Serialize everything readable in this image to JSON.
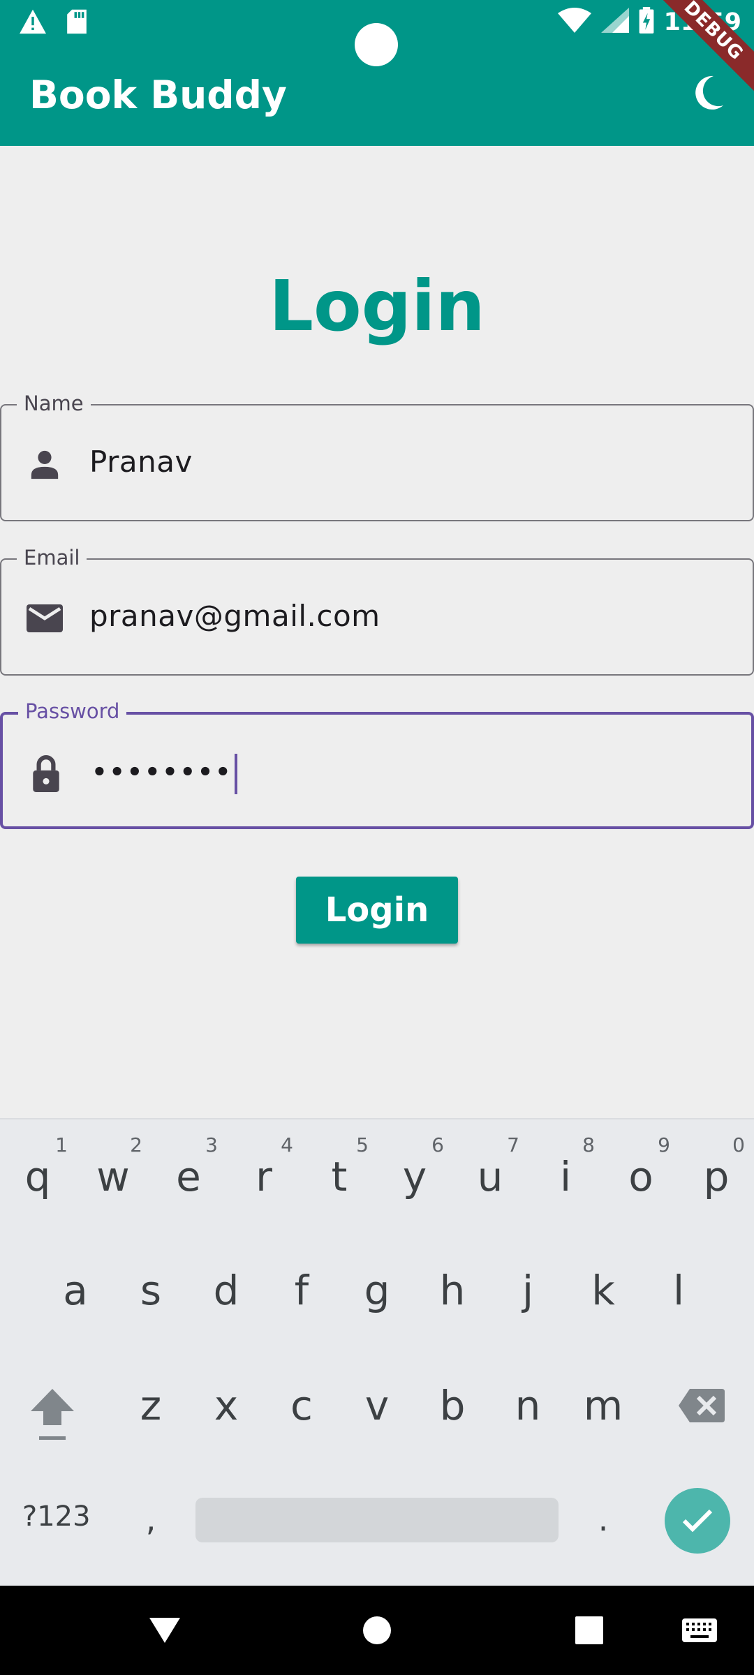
{
  "status_bar": {
    "time": "11:59",
    "icons": [
      "warning-icon",
      "sd-card-icon",
      "wifi-icon",
      "signal-icon",
      "battery-charging-icon"
    ]
  },
  "app_bar": {
    "title": "Book Buddy",
    "theme_icon": "moon-icon",
    "debug_banner": "DEBUG",
    "color": "#009688"
  },
  "form": {
    "title": "Login",
    "fields": [
      {
        "label": "Name",
        "value": "Pranav",
        "icon": "person-icon"
      },
      {
        "label": "Email",
        "value": "pranav@gmail.com",
        "icon": "mail-icon"
      },
      {
        "label": "Password",
        "value": "••••••••",
        "icon": "lock-icon",
        "focused": true
      }
    ],
    "submit_label": "Login"
  },
  "keyboard": {
    "row1": [
      "q",
      "w",
      "e",
      "r",
      "t",
      "y",
      "u",
      "i",
      "o",
      "p"
    ],
    "row1_hints": [
      "1",
      "2",
      "3",
      "4",
      "5",
      "6",
      "7",
      "8",
      "9",
      "0"
    ],
    "row2": [
      "a",
      "s",
      "d",
      "f",
      "g",
      "h",
      "j",
      "k",
      "l"
    ],
    "row3": [
      "z",
      "x",
      "c",
      "v",
      "b",
      "n",
      "m"
    ],
    "symbols_label": "?123",
    "comma": ",",
    "period": ".",
    "enter_icon": "check-icon",
    "accent": "#4db6ac"
  },
  "nav_bar": {
    "icons": [
      "back-icon",
      "home-icon",
      "recents-icon",
      "keyboard-switch-icon"
    ]
  }
}
